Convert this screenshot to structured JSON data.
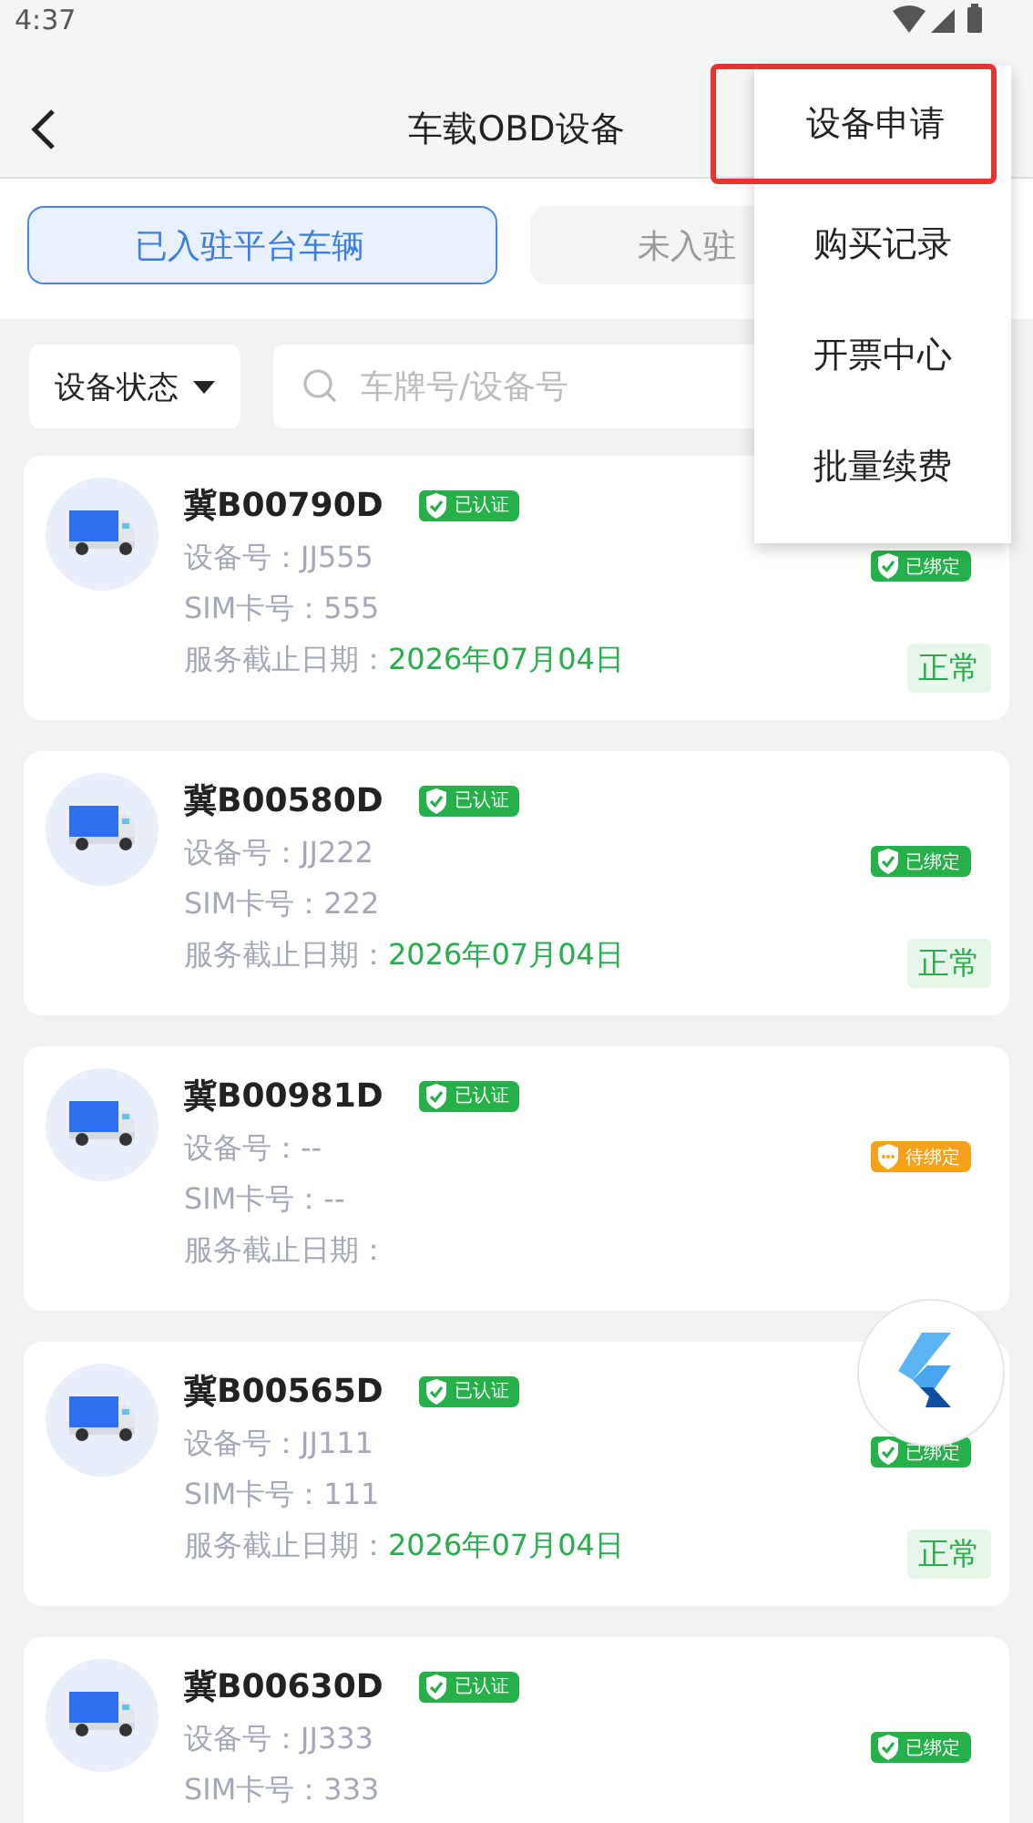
{
  "status_bar": {
    "time": "4:37"
  },
  "app_bar": {
    "title": "车载OBD设备"
  },
  "tabs": [
    {
      "label": "已入驻平台车辆",
      "selected": true
    },
    {
      "label": "未入驻",
      "selected": false
    }
  ],
  "filter": {
    "label": "设备状态",
    "search_placeholder": "车牌号/设备号"
  },
  "vehicles": [
    {
      "plate": "冀B00790D",
      "verified": "已认证",
      "bind": {
        "kind": "bound",
        "label": "已绑定"
      },
      "device_label": "设备号：",
      "device": "JJ555",
      "sim_label": "SIM卡号：",
      "sim": "555",
      "date_label": "服务截止日期：",
      "date": "2026年07月04日",
      "status": "正常"
    },
    {
      "plate": "冀B00580D",
      "verified": "已认证",
      "bind": {
        "kind": "bound",
        "label": "已绑定"
      },
      "device_label": "设备号：",
      "device": "JJ222",
      "sim_label": "SIM卡号：",
      "sim": "222",
      "date_label": "服务截止日期：",
      "date": "2026年07月04日",
      "status": "正常"
    },
    {
      "plate": "冀B00981D",
      "verified": "已认证",
      "bind": {
        "kind": "pending",
        "label": "待绑定"
      },
      "device_label": "设备号：",
      "device": "--",
      "sim_label": "SIM卡号：",
      "sim": "--",
      "date_label": "服务截止日期："
    },
    {
      "plate": "冀B00565D",
      "verified": "已认证",
      "bind": {
        "kind": "bound",
        "label": "已绑定"
      },
      "device_label": "设备号：",
      "device": "JJ111",
      "sim_label": "SIM卡号：",
      "sim": "111",
      "date_label": "服务截止日期：",
      "date": "2026年07月04日",
      "status": "正常"
    },
    {
      "plate": "冀B00630D",
      "verified": "已认证",
      "bind": {
        "kind": "bound",
        "label": "已绑定"
      },
      "device_label": "设备号：",
      "device": "JJ333",
      "sim_label": "SIM卡号：",
      "sim": "333"
    }
  ],
  "menu": {
    "items": [
      {
        "label": "设备申请",
        "selected": true
      },
      {
        "label": "购买记录",
        "selected": false
      },
      {
        "label": "开票中心",
        "selected": false
      },
      {
        "label": "批量续费",
        "selected": false
      }
    ]
  }
}
